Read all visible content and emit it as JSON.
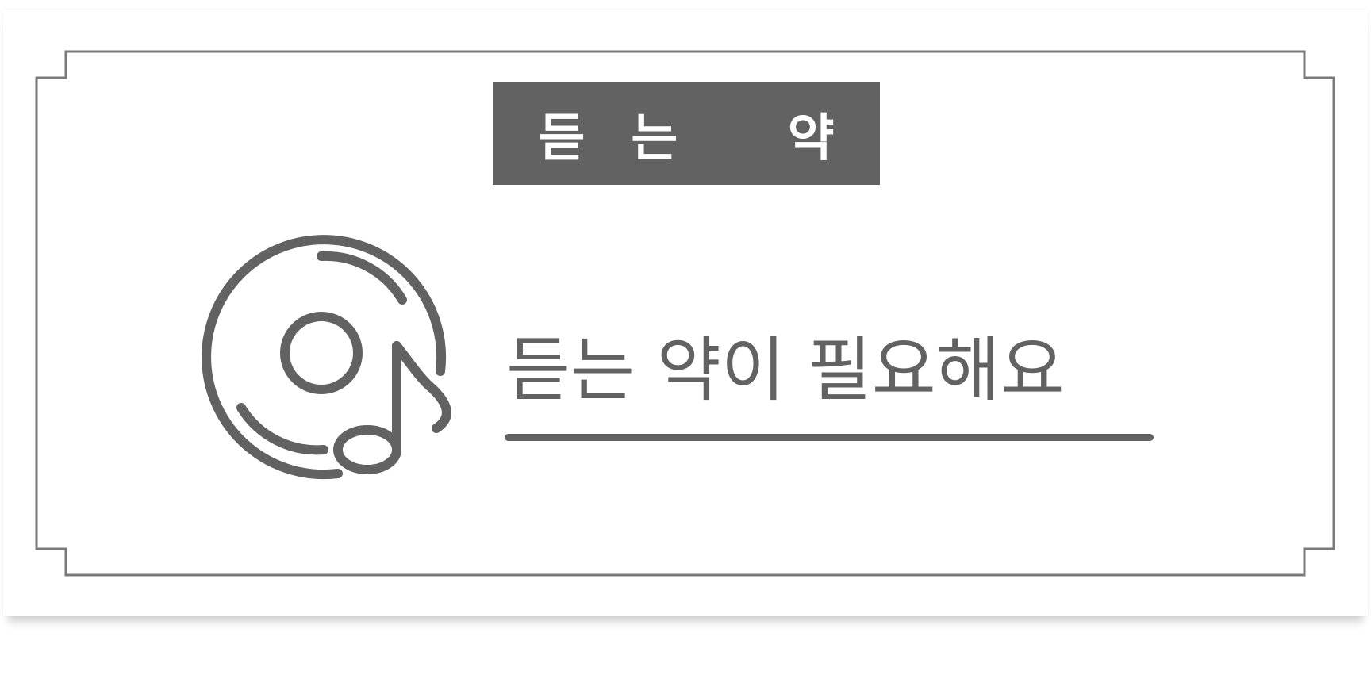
{
  "sign": {
    "title": "듣는 약",
    "message": "듣는 약이 필요해요",
    "icon": "music-disc-icon"
  },
  "colors": {
    "primary": "#626262",
    "frame": "#7a7a7a",
    "background": "#ffffff"
  }
}
